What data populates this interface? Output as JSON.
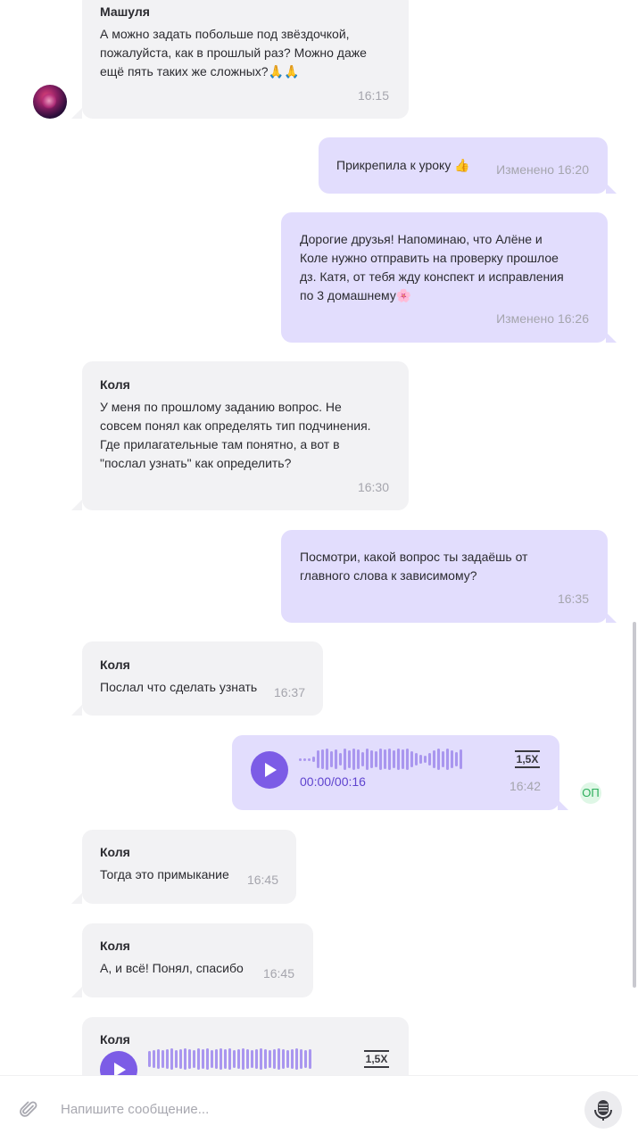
{
  "messages": [
    {
      "author": "Машуля",
      "text": "А можно задать побольше под звёздочкой,\nпожалуйста, как в прошлый раз? Можно даже\nещё пять таких же сложных?🙏🙏",
      "time": "16:15"
    },
    {
      "text": "Прикрепила к уроку 👍",
      "time": "Изменено 16:20"
    },
    {
      "text": "Дорогие друзья! Напоминаю, что Алёне и\nКоле нужно отправить на проверку прошлое\nдз. Катя, от тебя жду конспект и исправления\nпо 3 домашнему🌸",
      "time": "Изменено 16:26"
    },
    {
      "author": "Коля",
      "text": "У меня по прошлому заданию вопрос. Не\nсовсем понял как определять тип подчинения.\nГде прилагательные там понятно, а вот в\n\"послал узнать\" как определить?",
      "time": "16:30"
    },
    {
      "text": "Посмотри, какой вопрос ты задаёшь от\nглавного слова к зависимому?",
      "time": "16:35"
    },
    {
      "author": "Коля",
      "text": "Послал что сделать узнать",
      "time": "16:37"
    },
    {
      "voice_duration": "00:00/00:16",
      "speed": "1,5X",
      "time": "16:42",
      "sender_badge": "ОП"
    },
    {
      "author": "Коля",
      "text": "Тогда это примыкание",
      "time": "16:45"
    },
    {
      "author": "Коля",
      "text": "А, и всё! Понял, спасибо",
      "time": "16:45"
    },
    {
      "author": "Коля",
      "speed": "1,5X"
    }
  ],
  "composer": {
    "placeholder": "Напишите сообщение..."
  },
  "colors": {
    "incoming_bubble": "#f2f2f4",
    "outgoing_bubble": "#e2ddfd",
    "accent": "#7c5ce6",
    "waveform": "#a996ef"
  },
  "icons": {
    "attach": "paperclip-icon",
    "voice": "microphone-icon",
    "play": "play-icon"
  }
}
